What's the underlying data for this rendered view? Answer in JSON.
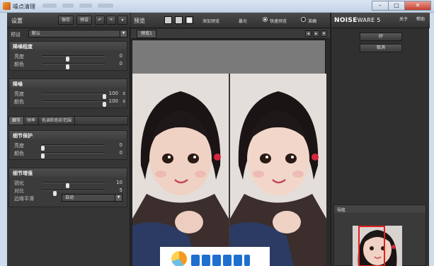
{
  "window": {
    "title": "噪点清理",
    "minimize": "–",
    "maximize": "□",
    "close": "✕"
  },
  "left": {
    "title": "设置",
    "save_btn": "保存",
    "preset_btn": "预设",
    "undo_icon": "↶",
    "redo_icon": "↷",
    "menu_icon": "▾",
    "preset_label": "预设",
    "preset_value": "默认",
    "groups": [
      {
        "title": "降噪程度",
        "rows": [
          {
            "label": "亮度",
            "value": "0",
            "level": 0.4
          },
          {
            "label": "颜色",
            "value": "0",
            "level": 0.4
          }
        ]
      },
      {
        "title": "降噪",
        "rows": [
          {
            "label": "亮度",
            "value": "100",
            "unit": "s",
            "level": 1.0
          },
          {
            "label": "颜色",
            "value": "100",
            "unit": "s",
            "level": 1.0
          }
        ]
      },
      {
        "title": "细节保护",
        "rows": [
          {
            "label": "亮度",
            "value": "0",
            "level": 0.0
          },
          {
            "label": "颜色",
            "value": "0",
            "level": 0.0
          }
        ]
      },
      {
        "title": "细节增强",
        "rows": [
          {
            "label": "锐化",
            "value": "10",
            "level": 0.4
          },
          {
            "label": "对比",
            "value": "5",
            "level": 0.2
          }
        ],
        "edge_label": "边缘平滑",
        "edge_value": "自动"
      }
    ],
    "tabs": [
      "细节",
      "频率",
      "色调和色彩范围"
    ]
  },
  "center": {
    "title": "预览",
    "add_preview": "添加预览",
    "exposure": "暴光",
    "fast_preview": "快速预览",
    "accurate": "准确",
    "preview_tab": "预览1",
    "nav_left": "◂",
    "nav_right": "▸",
    "nav_down": "▾"
  },
  "right": {
    "logo_bold": "NOISE",
    "logo_lite": "WARE 5",
    "about": "关于",
    "help": "帮助",
    "ok": "好",
    "cancel": "取消",
    "navigator": "导航"
  },
  "colors": {
    "panel": "#353535",
    "toolbar": "#3f3f3f",
    "accent_red": "#e02020"
  }
}
